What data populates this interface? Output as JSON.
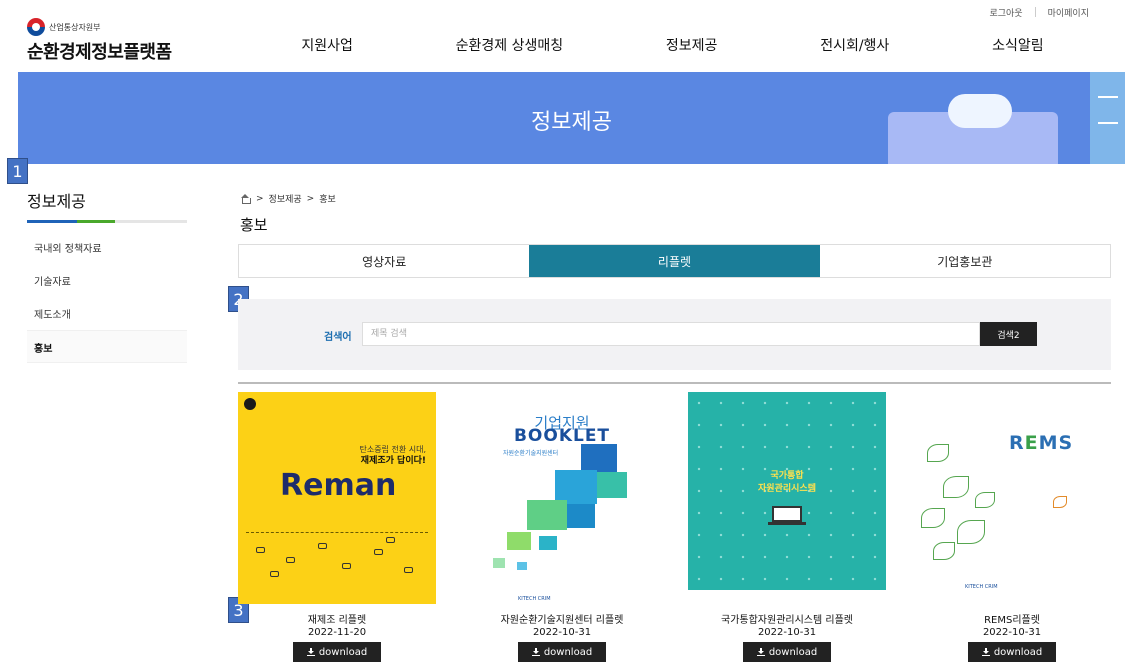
{
  "header": {
    "ministry": "산업통상자원부",
    "site_name": "순환경제정보플랫폼",
    "util": [
      "로그아웃",
      "마이페이지"
    ],
    "nav": [
      "지원사업",
      "순환경제 상생매칭",
      "정보제공",
      "전시회/행사",
      "소식알림"
    ]
  },
  "banner": {
    "title": "정보제공"
  },
  "markers": [
    "1",
    "2",
    "3"
  ],
  "sidebar": {
    "title": "정보제공",
    "items": [
      {
        "label": "국내외 정책자료",
        "active": false
      },
      {
        "label": "기술자료",
        "active": false
      },
      {
        "label": "제도소개",
        "active": false
      },
      {
        "label": "홍보",
        "active": true
      }
    ]
  },
  "breadcrumb": [
    "정보제공",
    "홍보"
  ],
  "breadcrumb_sep": ">",
  "page_title": "홍보",
  "tabs": [
    {
      "label": "영상자료",
      "active": false
    },
    {
      "label": "리플렛",
      "active": true
    },
    {
      "label": "기업홍보관",
      "active": false
    }
  ],
  "search": {
    "label": "검색어",
    "placeholder": "제목 검색",
    "value": "",
    "button": "검색2"
  },
  "cards": [
    {
      "title": "재제조 리플렛",
      "date": "2022-11-20",
      "download": "download",
      "cover": {
        "headline": "Reman",
        "tagline1": "탄소중립 전환 시대,",
        "tagline2": "재제조가 답이다!"
      }
    },
    {
      "title": "자원순환기술지원센터 리플렛",
      "date": "2022-10-31",
      "download": "download",
      "cover": {
        "line1": "기업지원",
        "line2": "BOOKLET",
        "line3": "자원순환기술지원센터",
        "foot": "KITECH  CRIM"
      }
    },
    {
      "title": "국가통합자원관리시스템 리플렛",
      "date": "2022-10-31",
      "download": "download",
      "cover": {
        "title1": "국가통합",
        "title2": "자원관리시스템"
      }
    },
    {
      "title": "REMS리플렛",
      "date": "2022-10-31",
      "download": "download",
      "cover": {
        "logo_a": "R",
        "logo_b": "E",
        "logo_c": "MS",
        "foot": "KITECH  CRIM"
      }
    }
  ],
  "colors": {
    "banner": "#5a87e2",
    "tab_active": "#1a7d98",
    "marker": "#4472c4",
    "reman_bg": "#fcd116",
    "teal_bg": "#26b2a8"
  }
}
